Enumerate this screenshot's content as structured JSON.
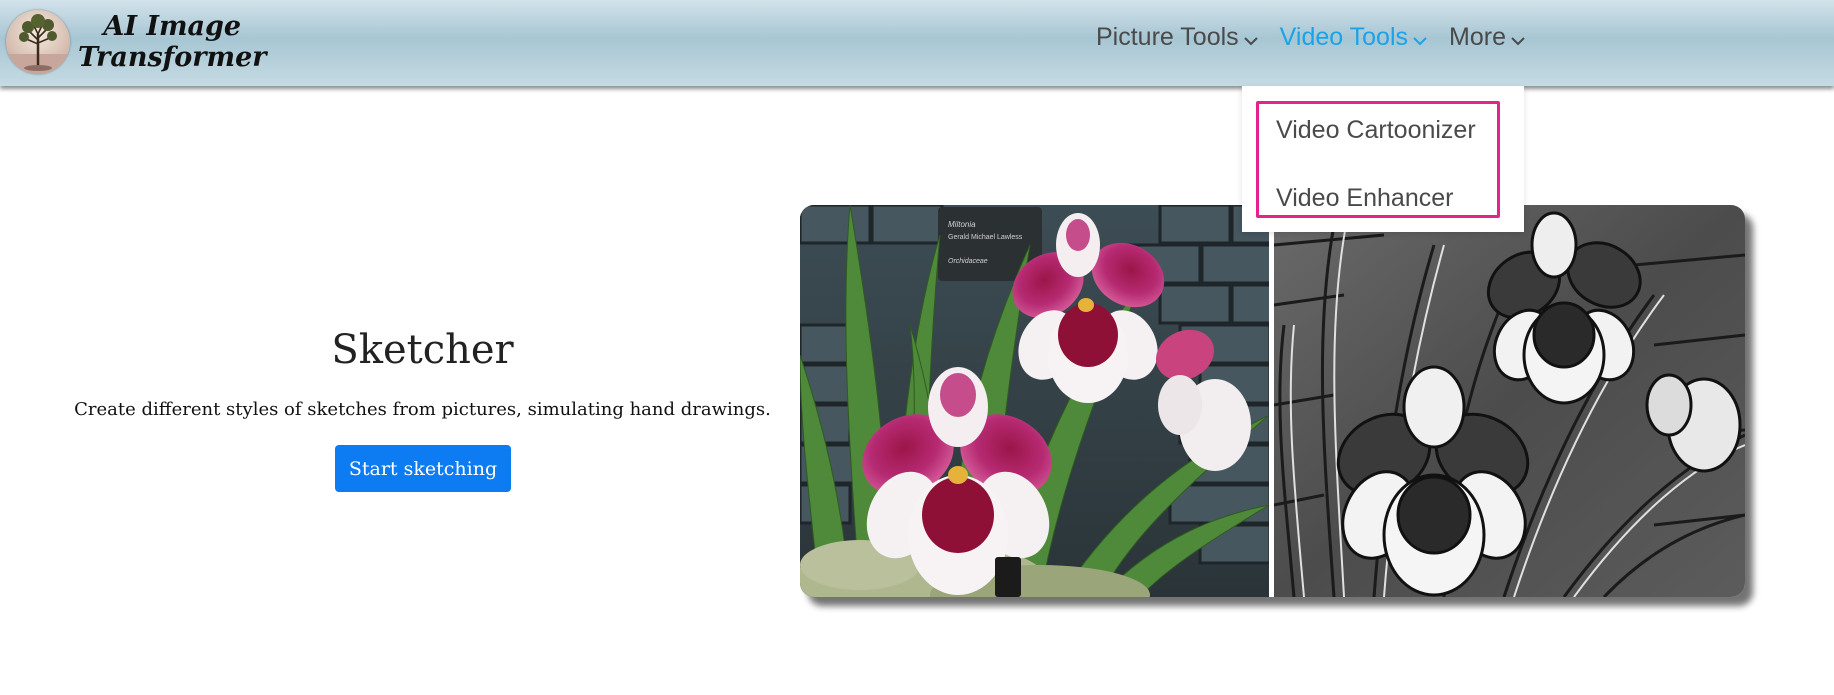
{
  "logo": {
    "line1": "AI Image",
    "line2": "Transformer"
  },
  "nav": {
    "items": [
      {
        "label": "Picture Tools",
        "active": false
      },
      {
        "label": "Video Tools",
        "active": true
      },
      {
        "label": "More",
        "active": false
      }
    ]
  },
  "dropdown": {
    "items": [
      "Video Cartoonizer",
      "Video Enhancer"
    ],
    "highlight_color": "#e5238c"
  },
  "hero": {
    "title": "Sketcher",
    "description": "Create different styles of sketches from pictures, simulating hand drawings.",
    "cta_label": "Start sketching"
  },
  "showcase": {
    "left_image": "orchid-photo",
    "right_image": "orchid-sketch",
    "plant_label_lines": [
      "Miltonia",
      "Gerald Michael Lawless",
      "Orchidaceae"
    ]
  },
  "colors": {
    "accent": "#1aa3e8",
    "button": "#0d7cf2"
  }
}
